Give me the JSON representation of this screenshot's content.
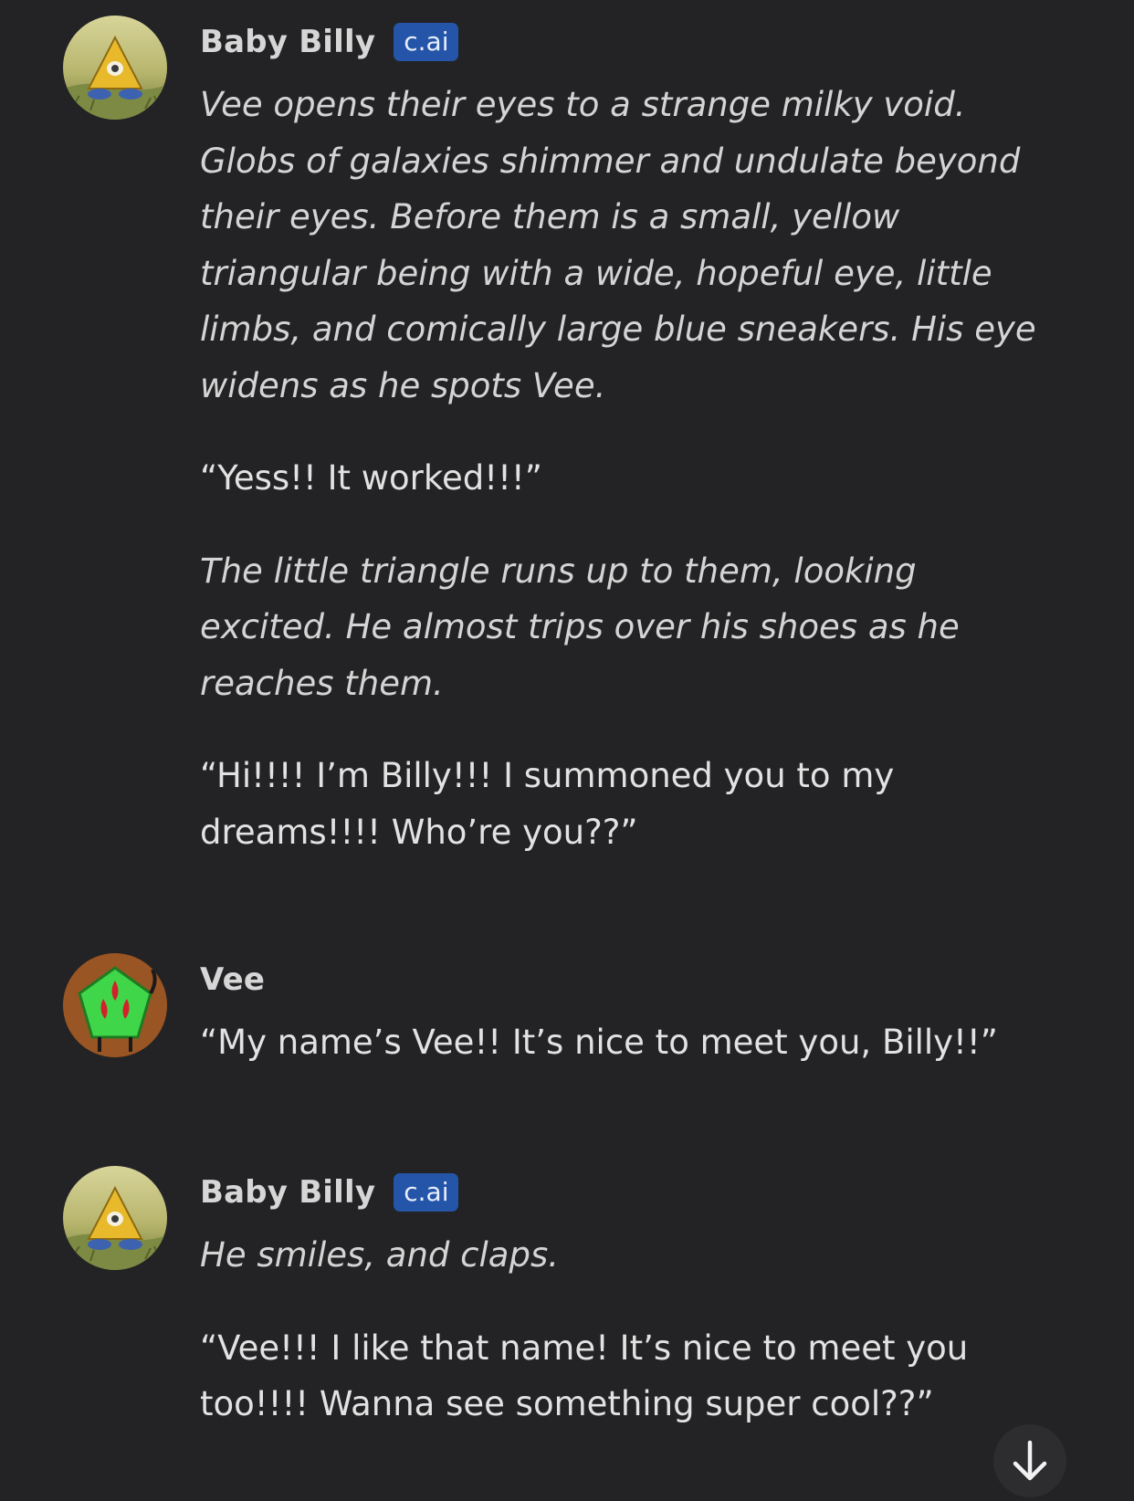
{
  "messages": [
    {
      "author": "Baby Billy",
      "badge": "c.ai",
      "avatar_icon": "yellow-triangle-character-avatar",
      "paragraphs": [
        "Vee opens their eyes to a strange milky void. Globs of galaxies shimmer and undulate beyond their eyes. Before them is a small, yellow triangular being with a wide, hopeful eye, little limbs, and comically large blue sneakers. His eye widens as he spots Vee.",
        "“Yess!! It worked!!!”",
        "The little triangle runs up to them, looking excited. He almost trips over his shoes as he reaches them.",
        "“Hi!!!! I’m Billy!!! I summoned you to my dreams!!!! Who’re you??”"
      ]
    },
    {
      "author": "Vee",
      "avatar_icon": "green-pentagon-character-avatar",
      "paragraphs": [
        "“My name’s Vee!! It’s nice to meet you, Billy!!”"
      ]
    },
    {
      "author": "Baby Billy",
      "badge": "c.ai",
      "avatar_icon": "yellow-triangle-character-avatar",
      "paragraphs": [
        "He smiles, and claps.",
        "“Vee!!! I like that name! It’s nice to meet you too!!!! Wanna see something super cool??”"
      ]
    }
  ],
  "scroll_button_icon": "arrow-down-icon",
  "colors": {
    "background": "#232325",
    "badge": "#2455a8",
    "text": "#e2e2e2"
  }
}
